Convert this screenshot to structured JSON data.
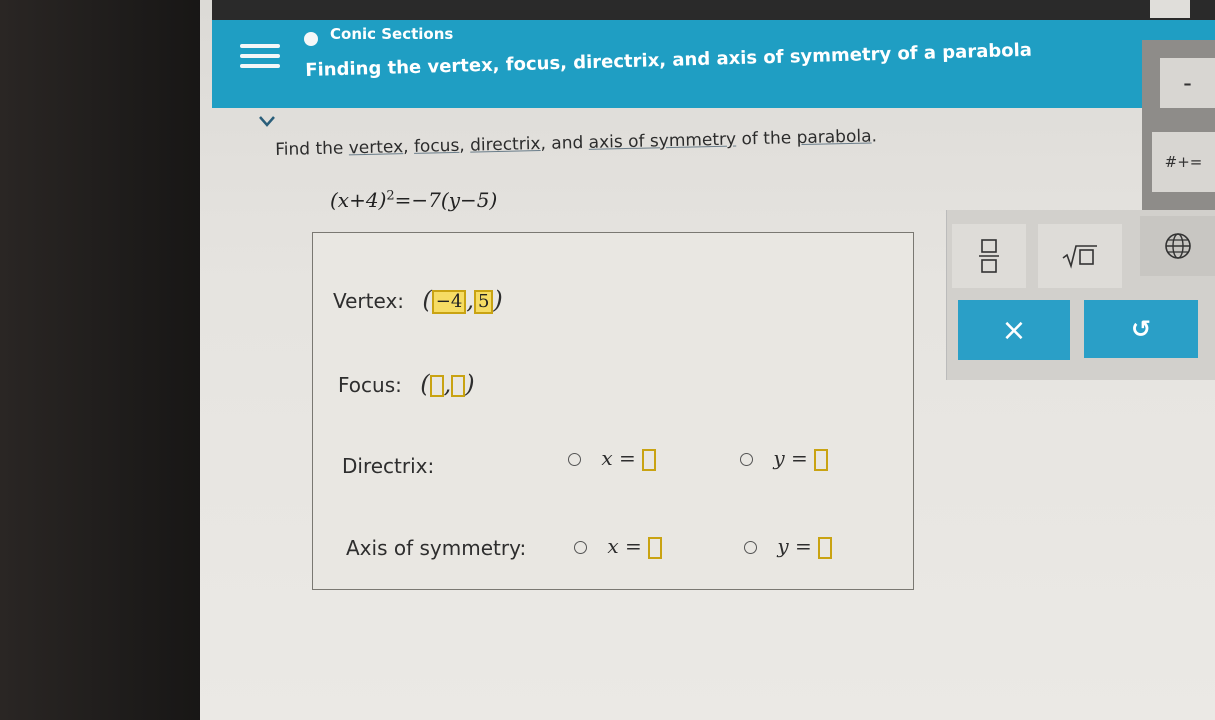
{
  "header": {
    "topic": "Conic Sections",
    "lesson_title": "Finding the vertex, focus, directrix, and axis of symmetry of a parabola"
  },
  "problem": {
    "prompt_parts": [
      "Find the ",
      "vertex",
      ", ",
      "focus",
      ", ",
      "directrix",
      ", and ",
      "axis of symmetry",
      " of the ",
      "parabola",
      "."
    ],
    "equation_left": "(x+4)",
    "equation_exp": "2",
    "equation_right": "=−7(y−5)"
  },
  "answers": {
    "vertex_label": "Vertex:",
    "vertex_value_x": "−4",
    "vertex_sep": ",",
    "vertex_value_y": "5",
    "focus_label": "Focus:",
    "focus_sep": ",",
    "directrix_label": "Directrix:",
    "axis_label": "Axis of symmetry:",
    "x_eq": "x =",
    "y_eq": "y ="
  },
  "keypad": {
    "times_label": "×",
    "undo_label": "↺",
    "hash_label": "#+="
  },
  "colors": {
    "header_blue": "#1f9ec3",
    "answer_highlight": "#f6dc64",
    "answer_border": "#c9a312"
  }
}
